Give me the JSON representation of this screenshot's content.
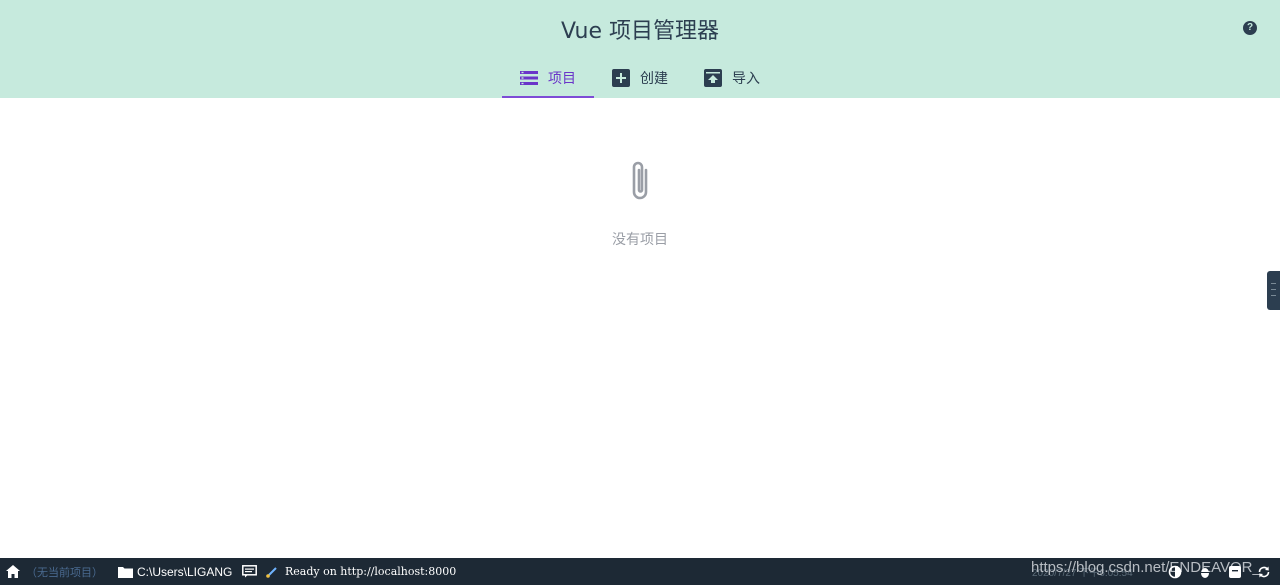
{
  "header": {
    "title": "Vue 项目管理器",
    "help_label": "?"
  },
  "tabs": [
    {
      "label": "项目",
      "icon": "list-icon",
      "active": true
    },
    {
      "label": "创建",
      "icon": "add-box-icon",
      "active": false
    },
    {
      "label": "导入",
      "icon": "unarchive-icon",
      "active": false
    }
  ],
  "empty_state": {
    "icon": "paperclip-icon",
    "text": "没有项目"
  },
  "statusbar": {
    "project": "（无当前项目）",
    "path": "C:\\Users\\LIGANG",
    "ready": "Ready on http://localhost:8000",
    "date": "2020/7/27 下午6:05:54",
    "watermark": "https://blog.csdn.net/ENDEAVOR_"
  },
  "colors": {
    "header_bg": "#c6eadd",
    "accent": "#7d4cd6",
    "statusbar_bg": "#1d2935",
    "text": "#2c3e50"
  }
}
